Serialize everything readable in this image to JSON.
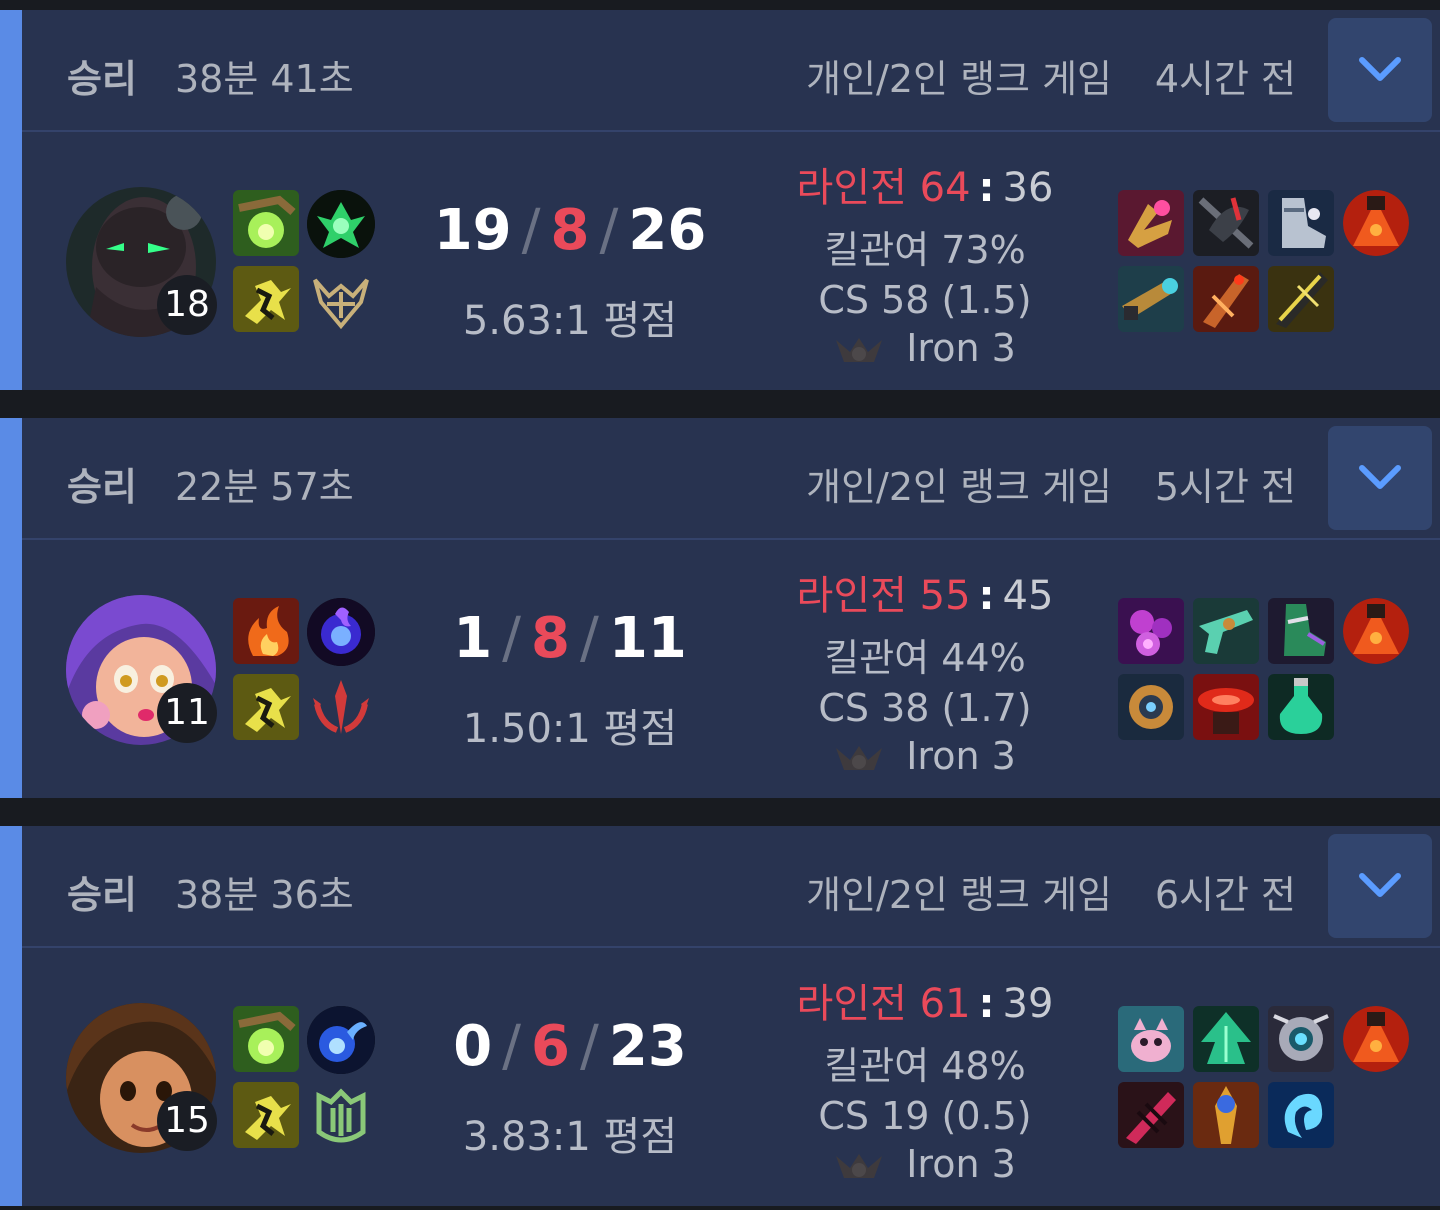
{
  "matches": [
    {
      "result": "승리",
      "duration": "38분 41초",
      "queue": "개인/2인 랭크 게임",
      "ago": "4시간 전",
      "champion_icon": "dark-cyber-champion-portrait",
      "level": "18",
      "spells": [
        "smite-icon",
        "ghost-icon"
      ],
      "runes": [
        "lethal-tempo-rune",
        "precision-secondary-rune"
      ],
      "kills": "19",
      "deaths": "8",
      "assists": "26",
      "kda_ratio": "5.63:1 평점",
      "laning_label": "라인전 64",
      "laning_opponent": "36",
      "kill_participation": "킬관여 73%",
      "cs": "CS 58 (1.5)",
      "tier": "Iron 3",
      "items": [
        "pink-claw-item",
        "black-axe-item",
        "steel-boots-item",
        "oracle-lens-trinket",
        "cannon-blade-item",
        "crimson-gun-item",
        "yellow-blade-item"
      ]
    },
    {
      "result": "승리",
      "duration": "22분 57초",
      "queue": "개인/2인 랭크 게임",
      "ago": "5시간 전",
      "champion_icon": "purple-hair-champion-portrait",
      "level": "11",
      "spells": [
        "ignite-icon",
        "flash-icon"
      ],
      "runes": [
        "electrocute-rune",
        "domination-secondary-rune"
      ],
      "kills": "1",
      "deaths": "8",
      "assists": "11",
      "kda_ratio": "1.50:1 평점",
      "laning_label": "라인전 55",
      "laning_opponent": "45",
      "kill_participation": "킬관여 44%",
      "cs": "CS 38 (1.7)",
      "tier": "Iron 3",
      "items": [
        "void-orb-item",
        "teal-pistol-item",
        "sorcerer-boots-item",
        "oracle-lens-trinket",
        "bronze-gear-item",
        "red-hat-item",
        "teal-potion-item"
      ]
    },
    {
      "result": "승리",
      "duration": "38분 36초",
      "queue": "개인/2인 랭크 게임",
      "ago": "6시간 전",
      "champion_icon": "brown-hair-champion-portrait",
      "level": "15",
      "spells": [
        "smite-icon",
        "flash-icon"
      ],
      "runes": [
        "arcane-comet-rune",
        "resolve-secondary-rune"
      ],
      "kills": "0",
      "deaths": "6",
      "assists": "23",
      "kda_ratio": "3.83:1 평점",
      "laning_label": "라인전 61",
      "laning_opponent": "39",
      "kill_participation": "킬관여 48%",
      "cs": "CS 19 (0.5)",
      "tier": "Iron 3",
      "items": [
        "pink-pet-item",
        "green-tree-item",
        "silver-orb-item",
        "oracle-lens-trinket",
        "red-claw-item",
        "golden-staff-item",
        "blue-spirit-item"
      ]
    }
  ],
  "colors": {
    "accent": "#5a8be6",
    "card": "#283350",
    "deaths": "#ea4a5a",
    "background": "#181b20"
  }
}
